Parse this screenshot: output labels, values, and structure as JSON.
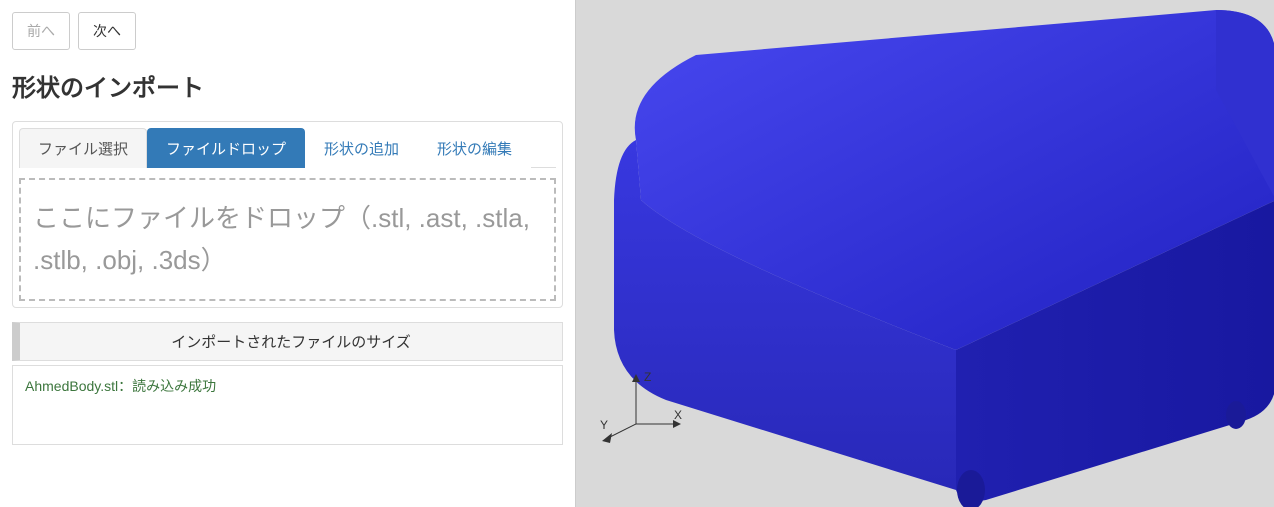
{
  "nav": {
    "prev_label": "前へ",
    "next_label": "次へ"
  },
  "page_title": "形状のインポート",
  "tabs": [
    {
      "label": "ファイル選択",
      "active": false
    },
    {
      "label": "ファイルドロップ",
      "active": true
    },
    {
      "label": "形状の追加",
      "active": false
    },
    {
      "label": "形状の編集",
      "active": false
    }
  ],
  "drop_zone": {
    "text": "ここにファイルをドロップ（.stl, .ast, .stla, .stlb, .obj, .3ds）"
  },
  "size_header": "インポートされたファイルのサイズ",
  "import_status": "AhmedBody.stl：読み込み成功",
  "viewport": {
    "axes": {
      "x": "X",
      "y": "Y",
      "z": "Z"
    },
    "model_color": "#2e2ee6"
  }
}
